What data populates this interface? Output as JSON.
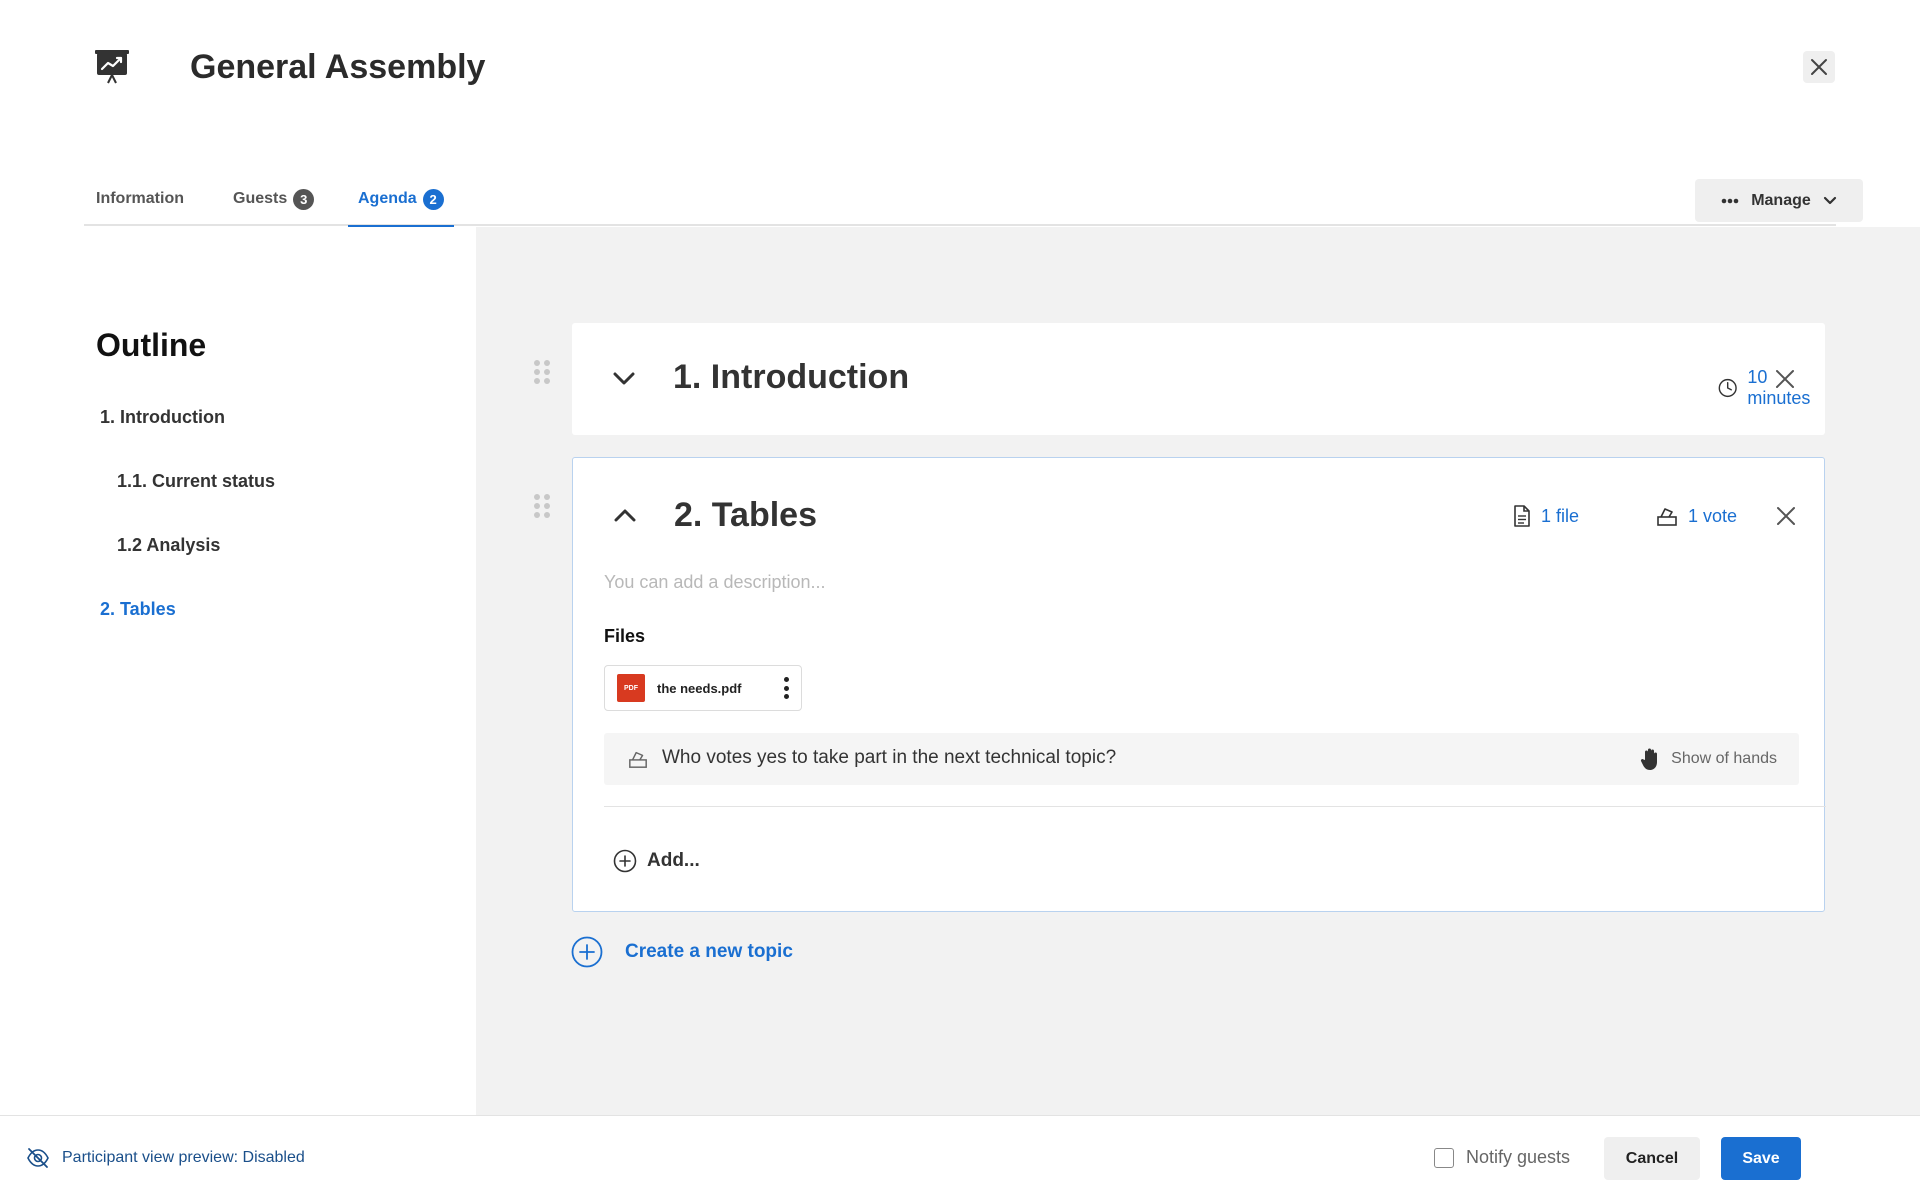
{
  "window": {
    "title": "General Assembly"
  },
  "tabs": [
    {
      "label": "Information",
      "badge": null,
      "active": false
    },
    {
      "label": "Guests",
      "badge": "3",
      "active": false
    },
    {
      "label": "Agenda",
      "badge": "2",
      "active": true
    }
  ],
  "manage": {
    "label": "Manage"
  },
  "outline": {
    "title": "Outline",
    "items": [
      {
        "label": "1. Introduction",
        "level": 1,
        "active": false
      },
      {
        "label": "1.1. Current status",
        "level": 2,
        "active": false
      },
      {
        "label": "1.2 Analysis",
        "level": 2,
        "active": false
      },
      {
        "label": "2. Tables",
        "level": 1,
        "active": true
      }
    ]
  },
  "topics": [
    {
      "title": "1. Introduction",
      "expanded": false,
      "duration": "10 minutes"
    },
    {
      "title": "2. Tables",
      "expanded": true,
      "files_count": "1 file",
      "votes_count": "1 vote",
      "description_placeholder": "You can add a description...",
      "files_label": "Files",
      "files": [
        {
          "name": "the needs.pdf",
          "type": "PDF"
        }
      ],
      "vote": {
        "question": "Who votes yes to take part in the next technical topic?",
        "type": "Show of hands"
      },
      "add_label": "Add..."
    }
  ],
  "create_topic": {
    "label": "Create a new topic"
  },
  "footer": {
    "preview": "Participant view preview: Disabled",
    "notify_label": "Notify guests",
    "notify_checked": false,
    "cancel_label": "Cancel",
    "save_label": "Save"
  },
  "colors": {
    "accent": "#1a6fd1",
    "pdf": "#d83a20",
    "panel_bg": "#f2f2f2"
  }
}
